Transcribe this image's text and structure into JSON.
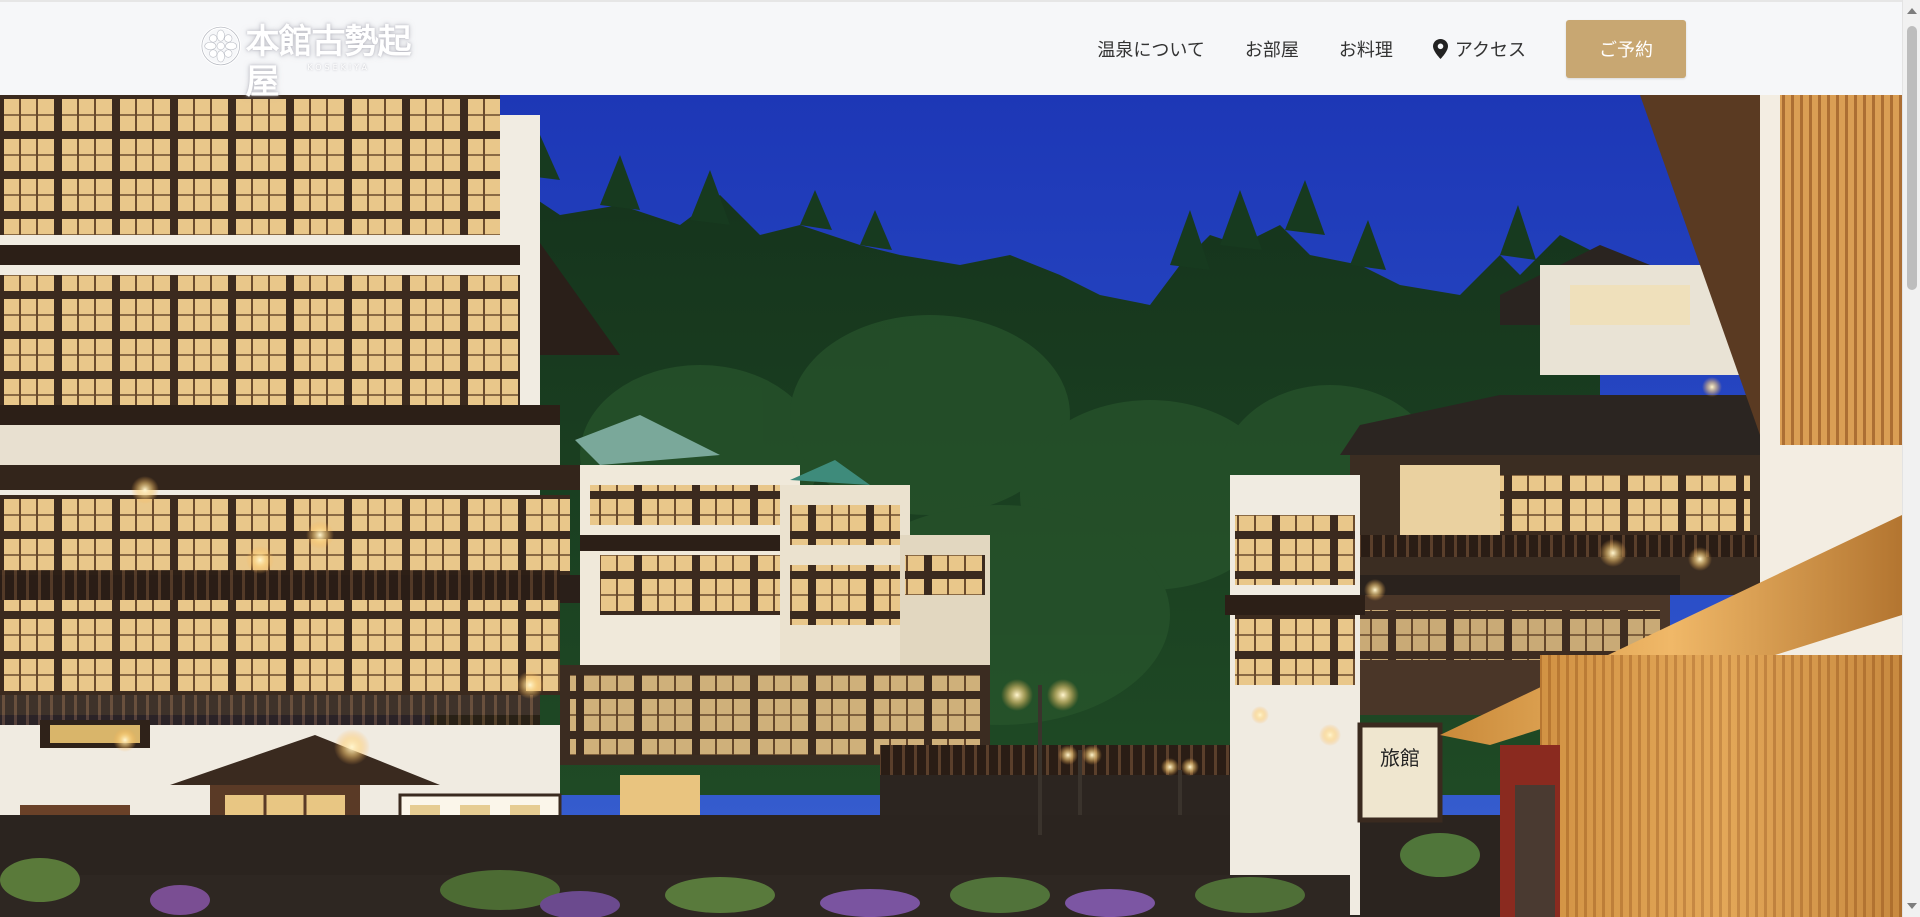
{
  "header": {
    "logo_text": "本館古勢起屋",
    "logo_sub": "KOSEKIYA",
    "nav": [
      {
        "label": "温泉について"
      },
      {
        "label": "お部屋"
      },
      {
        "label": "お料理"
      },
      {
        "label": "アクセス",
        "icon": "map-pin-icon"
      }
    ],
    "reserve_label": "ご予約"
  },
  "hero": {
    "image": "ginzan-onsen-evening-street-photo",
    "lantern_sign": "旅館"
  },
  "colors": {
    "header_bg": "#f6f7f9",
    "nav_text": "#333333",
    "reserve_button": "#c8a772",
    "sky": "#1f3fb5"
  }
}
